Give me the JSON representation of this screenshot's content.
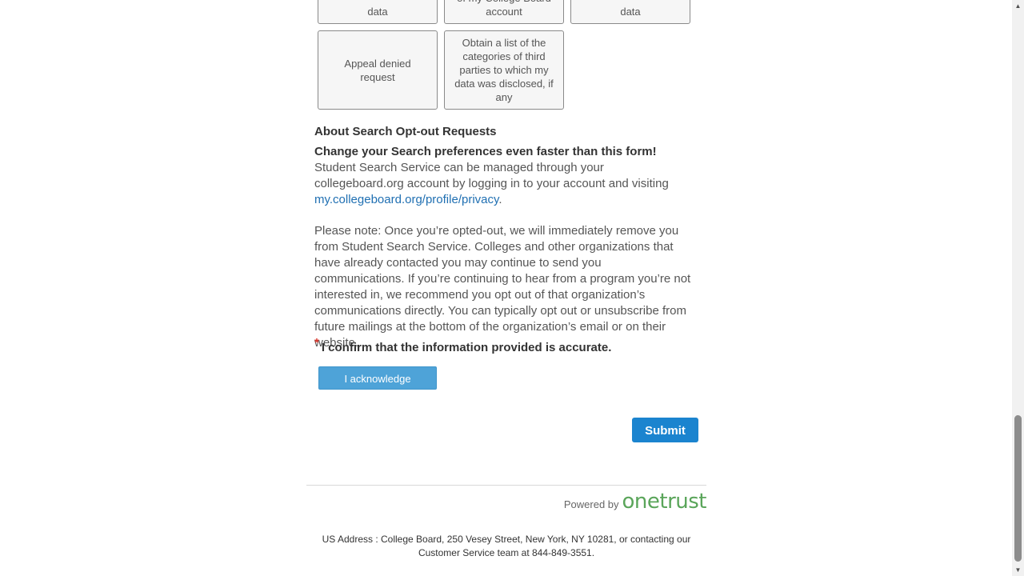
{
  "request_tiles": [
    {
      "label": "data"
    },
    {
      "label": "of my College Board account"
    },
    {
      "label": "data"
    },
    {
      "label": "Appeal denied request"
    },
    {
      "label": "Obtain a list of the categories of third parties to which my data was disclosed, if any"
    }
  ],
  "about": {
    "heading": "About Search Opt-out Requests",
    "lead_bold": "Change your Search preferences even faster than this form!",
    "lead_text": " Student Search Service can be managed through your collegeboard.org account by logging in to your account and visiting ",
    "link_text": "my.collegeboard.org/profile/privacy",
    "link_after": ".",
    "note": "Please note: Once you’re opted-out, we will immediately remove you from Student Search Service. Colleges and other organizations that have already contacted you may continue to send you communications. If you’re continuing to hear from a program you’re not interested in, we recommend you opt out of that organization’s communications directly. You can typically opt out or unsubscribe from future mailings at the bottom of the organization’s email or on their website."
  },
  "confirm": {
    "required_mark": "*",
    "label": "I confirm that the information provided is accurate.",
    "button_label": "I acknowledge"
  },
  "submit": {
    "label": "Submit"
  },
  "footer": {
    "powered_by": "Powered by",
    "logo_text": "onetrust",
    "address": "US Address : College Board, 250 Vesey Street, New York, NY 10281, or contacting our Customer Service team at 844-849-3551."
  },
  "colors": {
    "link": "#1f6fb2",
    "acknowledge_button": "#4ea3d8",
    "submit_button": "#1b84cf",
    "onetrust_logo": "#5aa55a",
    "required": "#d9362b"
  },
  "icons": {
    "scroll_up": "triangle-up-icon",
    "scroll_down": "triangle-down-icon"
  }
}
